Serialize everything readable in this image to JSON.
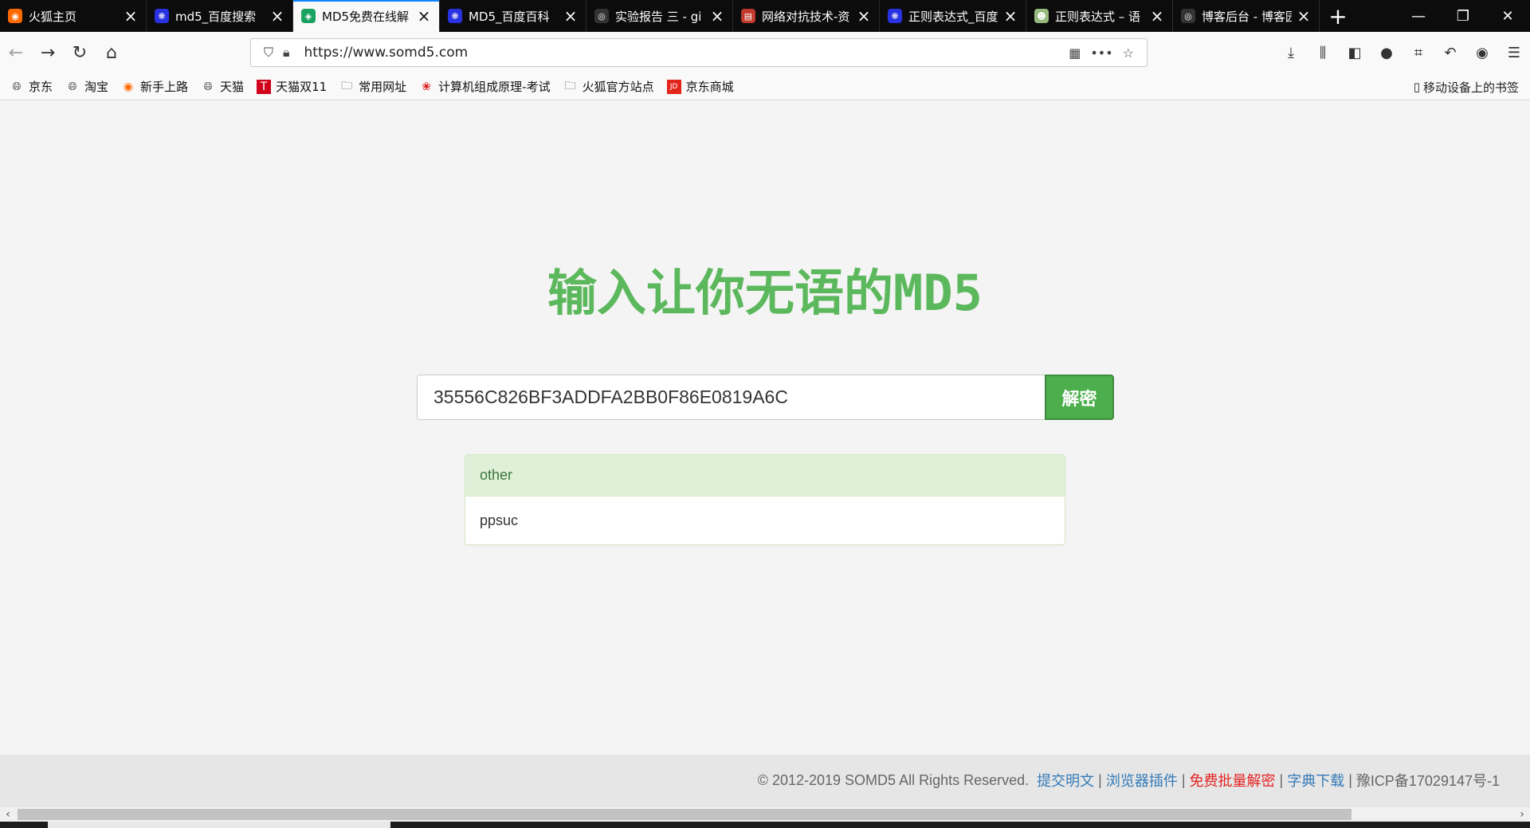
{
  "tabs": [
    {
      "title": "火狐主页",
      "favicon": "firefox-icon",
      "color": "#ff6a00",
      "active": false
    },
    {
      "title": "md5_百度搜索",
      "favicon": "baidu-paw-icon",
      "color": "#2932e1",
      "active": false
    },
    {
      "title": "MD5免费在线解",
      "favicon": "somd5-icon",
      "color": "#1aa260",
      "active": true
    },
    {
      "title": "MD5_百度百科",
      "favicon": "baidu-paw-icon",
      "color": "#2932e1",
      "active": false
    },
    {
      "title": "实验报告 三 - gi",
      "favicon": "github-icon",
      "color": "#333333",
      "active": false
    },
    {
      "title": "网络对抗技术-资",
      "favicon": "book-icon",
      "color": "#c0392b",
      "active": false
    },
    {
      "title": "正则表达式_百度",
      "favicon": "baidu-paw-icon",
      "color": "#2932e1",
      "active": false
    },
    {
      "title": "正则表达式 – 语",
      "favicon": "runoob-icon",
      "color": "#96b97d",
      "active": false
    },
    {
      "title": "博客后台 - 博客园",
      "favicon": "github-icon",
      "color": "#333333",
      "active": false
    }
  ],
  "address": {
    "url": "https://www.somd5.com"
  },
  "bookmarks": [
    {
      "label": "京东",
      "icon": "globe-icon"
    },
    {
      "label": "淘宝",
      "icon": "globe-icon"
    },
    {
      "label": "新手上路",
      "icon": "firefox-icon"
    },
    {
      "label": "天猫",
      "icon": "globe-icon"
    },
    {
      "label": "天猫双11",
      "icon": "tmall-icon"
    },
    {
      "label": "常用网址",
      "icon": "folder-icon"
    },
    {
      "label": "计算机组成原理-考试",
      "icon": "huawei-icon"
    },
    {
      "label": "火狐官方站点",
      "icon": "folder-icon"
    },
    {
      "label": "京东商城",
      "icon": "jd-icon"
    }
  ],
  "mobile_bookmarks": "移动设备上的书签",
  "page": {
    "headline": "输入让你无语的MD5",
    "hash_value": "35556C826BF3ADDFA2BB0F86E0819A6C",
    "decrypt_label": "解密",
    "result_type": "other",
    "result_value": "ppsuc"
  },
  "footer": {
    "copyright": "© 2012-2019 SOMD5 All Rights Reserved.",
    "links": [
      {
        "label": "提交明文",
        "color": "#337ab7"
      },
      {
        "label": "浏览器插件",
        "color": "#337ab7"
      },
      {
        "label": "免费批量解密",
        "color": "#e62323"
      },
      {
        "label": "字典下载",
        "color": "#337ab7"
      }
    ],
    "icp": "豫ICP备17029147号-1"
  },
  "colors": {
    "accent_green": "#5cb85c",
    "button_green": "#4cae4c",
    "panel_head": "#dff0d8"
  }
}
